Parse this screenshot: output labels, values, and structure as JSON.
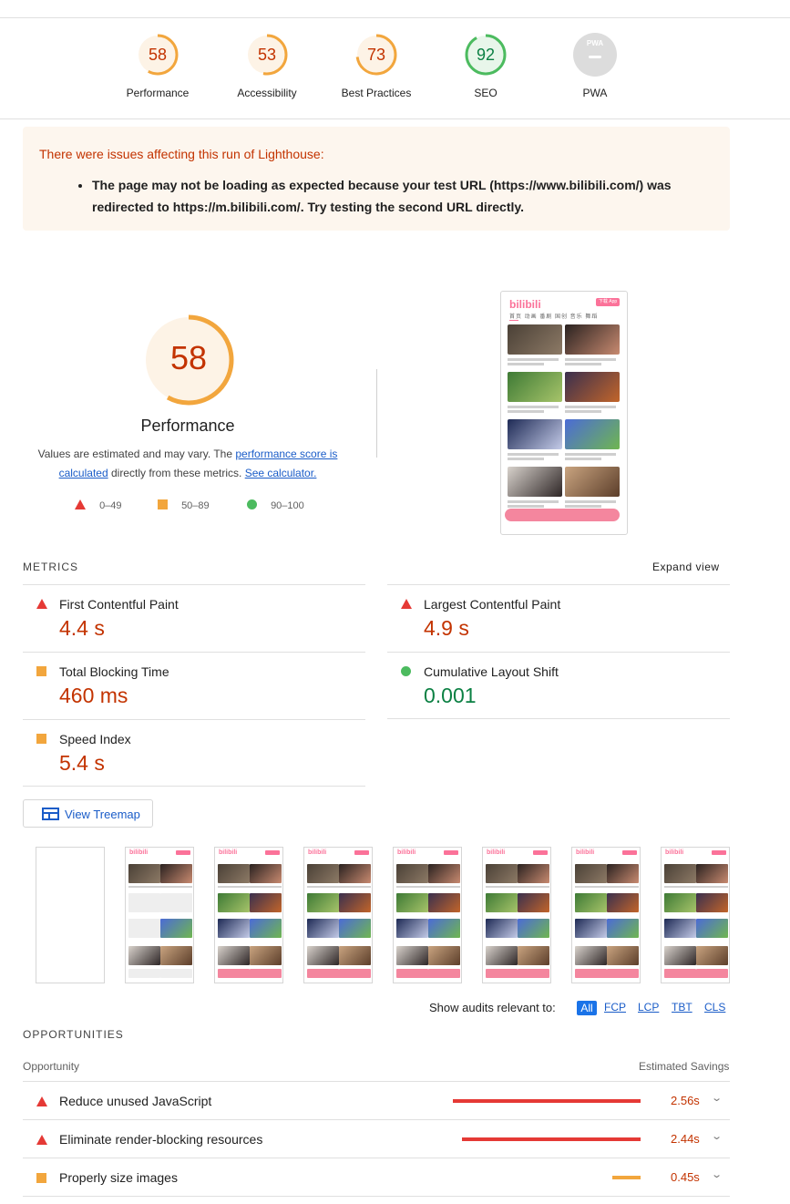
{
  "colors": {
    "fail": "#e53935",
    "average": "#f2a63d",
    "pass": "#4cbb5f",
    "fail_text": "#c33300",
    "average_text": "#c33300",
    "pass_text": "#0b8043",
    "link": "#1a5cc8"
  },
  "categories": [
    {
      "score": "58",
      "label": "Performance",
      "fraction": 0.58,
      "status": "average"
    },
    {
      "score": "53",
      "label": "Accessibility",
      "fraction": 0.53,
      "status": "average"
    },
    {
      "score": "73",
      "label": "Best Practices",
      "fraction": 0.73,
      "status": "average"
    },
    {
      "score": "92",
      "label": "SEO",
      "fraction": 0.92,
      "status": "pass"
    },
    {
      "score": "PWA",
      "label": "PWA",
      "status": "na"
    }
  ],
  "warning": {
    "title": "There were issues affecting this run of Lighthouse:",
    "item": "The page may not be loading as expected because your test URL (https://www.bilibili.com/) was redirected to https://m.bilibili.com/. Try testing the second URL directly."
  },
  "performance": {
    "score": "58",
    "fraction": 0.58,
    "title": "Performance",
    "desc_prefix": "Values are estimated and may vary. The ",
    "desc_link1": "performance score is calculated",
    "desc_middle": " directly from these metrics. ",
    "desc_link2": "See calculator.",
    "legend": [
      "0–49",
      "50–89",
      "90–100"
    ]
  },
  "screenshot": {
    "logo": "bilibili",
    "download_label": "下载 App",
    "tabs": "首页  动画  番剧  国创  音乐  舞蹈"
  },
  "metrics": {
    "heading": "METRICS",
    "expand_label": "Expand view",
    "items": [
      {
        "name": "First Contentful Paint",
        "value": "4.4 s",
        "status": "fail"
      },
      {
        "name": "Largest Contentful Paint",
        "value": "4.9 s",
        "status": "fail"
      },
      {
        "name": "Total Blocking Time",
        "value": "460 ms",
        "status": "average"
      },
      {
        "name": "Cumulative Layout Shift",
        "value": "0.001",
        "status": "pass"
      },
      {
        "name": "Speed Index",
        "value": "5.4 s",
        "status": "average"
      }
    ]
  },
  "treemap": {
    "label": "View Treemap",
    "icon": "treemap-icon"
  },
  "filmstrip": {
    "frame_count": 8
  },
  "filter": {
    "label": "Show audits relevant to:",
    "options": [
      "All",
      "FCP",
      "LCP",
      "TBT",
      "CLS"
    ],
    "selected": "All"
  },
  "opportunities": {
    "heading": "OPPORTUNITIES",
    "col_opportunity": "Opportunity",
    "col_savings": "Estimated Savings",
    "items": [
      {
        "title": "Reduce unused JavaScript",
        "savings": "2.56s",
        "savings_value": 2.56,
        "status": "fail"
      },
      {
        "title": "Eliminate render-blocking resources",
        "savings": "2.44s",
        "savings_value": 2.44,
        "status": "fail"
      },
      {
        "title": "Properly size images",
        "savings": "0.45s",
        "savings_value": 0.45,
        "status": "average"
      }
    ]
  }
}
